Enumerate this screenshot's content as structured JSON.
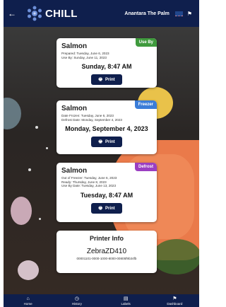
{
  "header": {
    "back_icon": "arrow-left-icon",
    "logo_text": "CHILL",
    "location": "Anantara The Palm",
    "language_icon": "language-selector-icon"
  },
  "colors": {
    "navy": "#0f1f4d",
    "use_by": "#3f9a3d",
    "freezer": "#3b7dd8",
    "defrost": "#9b3fc2"
  },
  "cards": [
    {
      "title": "Salmon",
      "tag": "Use By",
      "lines": [
        "Prepared: Tuesday, June 6, 2023",
        "Use By: Sunday, June 11, 2023"
      ],
      "time": "Sunday, 8:47 AM",
      "print_label": "Print"
    },
    {
      "title": "Salmon",
      "tag": "Freezer",
      "lines": [
        "Date Frozen: Tuesday, June 6, 2023",
        "Defrost Date: Monday, September 4, 2023"
      ],
      "time": "Monday, September 4, 2023",
      "print_label": "Print"
    },
    {
      "title": "Salmon",
      "tag": "Defrost",
      "lines": [
        "Out of Freezer: Tuesday, June 6, 2023",
        "Ready: Thursday, June 8, 2023",
        "Use By Date: Tuesday, June 13, 2023"
      ],
      "time": "Tuesday, 8:47 AM",
      "print_label": "Print"
    }
  ],
  "printer": {
    "title": "Printer Info",
    "name": "ZebraZD410",
    "id": "00001101-0000-1000-8000-00805f9b34fb"
  },
  "nav": [
    {
      "label": "Home",
      "icon": "home-icon"
    },
    {
      "label": "History",
      "icon": "history-icon"
    },
    {
      "label": "Labels",
      "icon": "labels-icon"
    },
    {
      "label": "Dashboard",
      "icon": "dashboard-icon"
    }
  ]
}
